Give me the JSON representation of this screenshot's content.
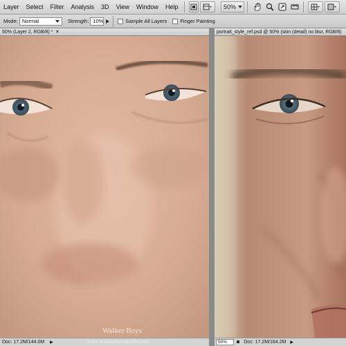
{
  "menu": [
    "Layer",
    "Select",
    "Filter",
    "Analysis",
    "3D",
    "View",
    "Window",
    "Help"
  ],
  "toolbar": {
    "zoom": "50%"
  },
  "options": {
    "mode_label": "Mode:",
    "mode_value": "Normal",
    "strength_label": "Strength:",
    "strength_value": "10%",
    "sample_all_layers": "Sample All Layers",
    "finger_painting": "Finger Painting"
  },
  "documents": {
    "left": {
      "tab_title": "50% (Layer 2, RGB/8) *",
      "status_doc": "Doc: 17.2M/144.0M"
    },
    "right": {
      "tab_title": "portrait_style_ref.psd @ 50% (skin (detail) no blur, RGB/8)",
      "zoom": "50%",
      "status_doc": "Doc: 17.2M/164.2M"
    }
  },
  "watermark": {
    "name": "Walker Boys",
    "url": "www.walkerboysstudio.com"
  }
}
